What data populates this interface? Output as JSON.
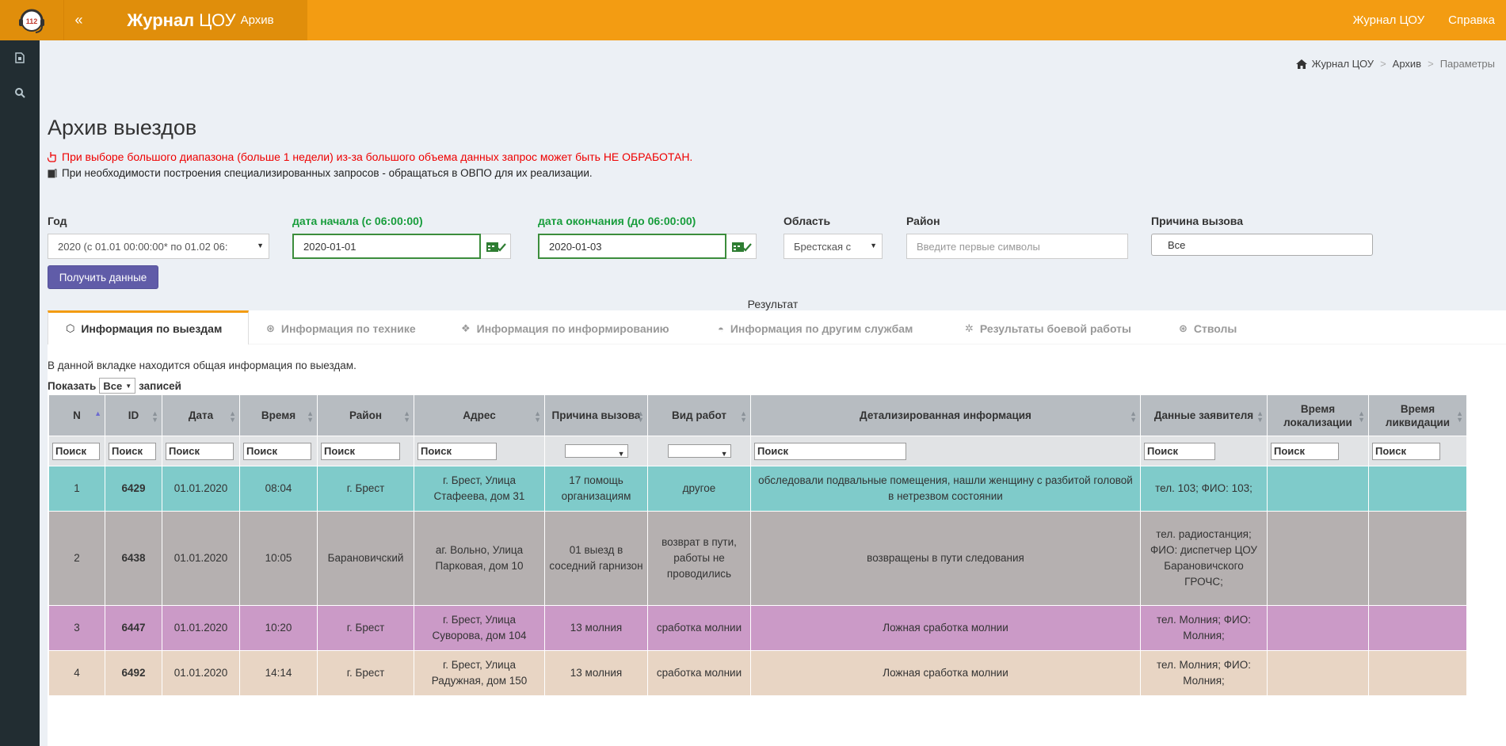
{
  "header": {
    "logo_text": "112",
    "collapse_icon": "«",
    "brand_bold": "Журнал",
    "brand_mid": "ЦОУ",
    "brand_small": "Архив",
    "nav": [
      "Журнал ЦОУ",
      "Справка"
    ]
  },
  "breadcrumb": {
    "home": "Журнал ЦОУ",
    "sep1": ">",
    "item1": "Архив",
    "sep2": ">",
    "current": "Параметры"
  },
  "page": {
    "title": "Архив выездов",
    "warning": "При выборе большого диапазона (больше 1 недели) из-за большого объема данных запрос может быть НЕ ОБРАБОТАН.",
    "note": "При необходимости построения специализированных запросов - обращаться в ОВПО для их реализации."
  },
  "filters": {
    "year_label": "Год",
    "year_value": "2020 (с 01.01 00:00:00* по 01.02 06:",
    "start_label": "дата начала (с 06:00:00)",
    "start_value": "2020-01-01",
    "end_label": "дата окончания (до 06:00:00)",
    "end_value": "2020-01-03",
    "region_label": "Область",
    "region_value": "Брестская с",
    "district_label": "Район",
    "district_placeholder": "Введите первые символы",
    "reason_label": "Причина вызова",
    "reason_value": "Все",
    "submit": "Получить данные"
  },
  "result_label": "Результат",
  "tabs": [
    "Информация по выездам",
    "Информация по технике",
    "Информация по информированию",
    "Информация по другим службам",
    "Результаты боевой работы",
    "Стволы"
  ],
  "panel": {
    "description": "В данной вкладке находится общая информация по выездам.",
    "show_prefix": "Показать",
    "show_value": "Все",
    "show_suffix": "записей"
  },
  "table": {
    "columns": [
      "N",
      "ID",
      "Дата",
      "Время",
      "Район",
      "Адрес",
      "Причина вызова",
      "Вид работ",
      "Детализированная информация",
      "Данные заявителя",
      "Время локализации",
      "Время ликвидации"
    ],
    "search_placeholder": "Поиск",
    "rows": [
      [
        "1",
        "6429",
        "01.01.2020",
        "08:04",
        "г. Брест",
        "г. Брест, Улица Стафеева, дом 31",
        "17 помощь организациям",
        "другое",
        "обследовали подвальные помещения, нашли женщину с разбитой головой в нетрезвом состоянии",
        "тел. 103; ФИО: 103;",
        "",
        ""
      ],
      [
        "2",
        "6438",
        "01.01.2020",
        "10:05",
        "Барановичский",
        "аг. Вольно, Улица Парковая, дом 10",
        "01 выезд в соседний гарнизон",
        "возврат в пути, работы не проводились",
        "возвращены в пути следования",
        "тел. радиостанция; ФИО: диспетчер ЦОУ Барановичского ГРОЧС;",
        "",
        ""
      ],
      [
        "3",
        "6447",
        "01.01.2020",
        "10:20",
        "г. Брест",
        "г. Брест, Улица Суворова, дом 104",
        "13 молния",
        "сработка молнии",
        "Ложная сработка молнии",
        "тел. Молния; ФИО: Молния;",
        "",
        ""
      ],
      [
        "4",
        "6492",
        "01.01.2020",
        "14:14",
        "г. Брест",
        "г. Брест, Улица Радужная, дом 150",
        "13 молния",
        "сработка молнии",
        "Ложная сработка молнии",
        "тел. Молния; ФИО: Молния;",
        "",
        ""
      ]
    ]
  },
  "colors": {
    "accent": "#f39c12",
    "sidebar": "#222d32",
    "button": "#605ca8",
    "warning": "#ee0000",
    "row1": "#7fcbca",
    "row2": "#b5b0b0",
    "row3": "#cb9ac7",
    "row4": "#e8d5c4"
  }
}
